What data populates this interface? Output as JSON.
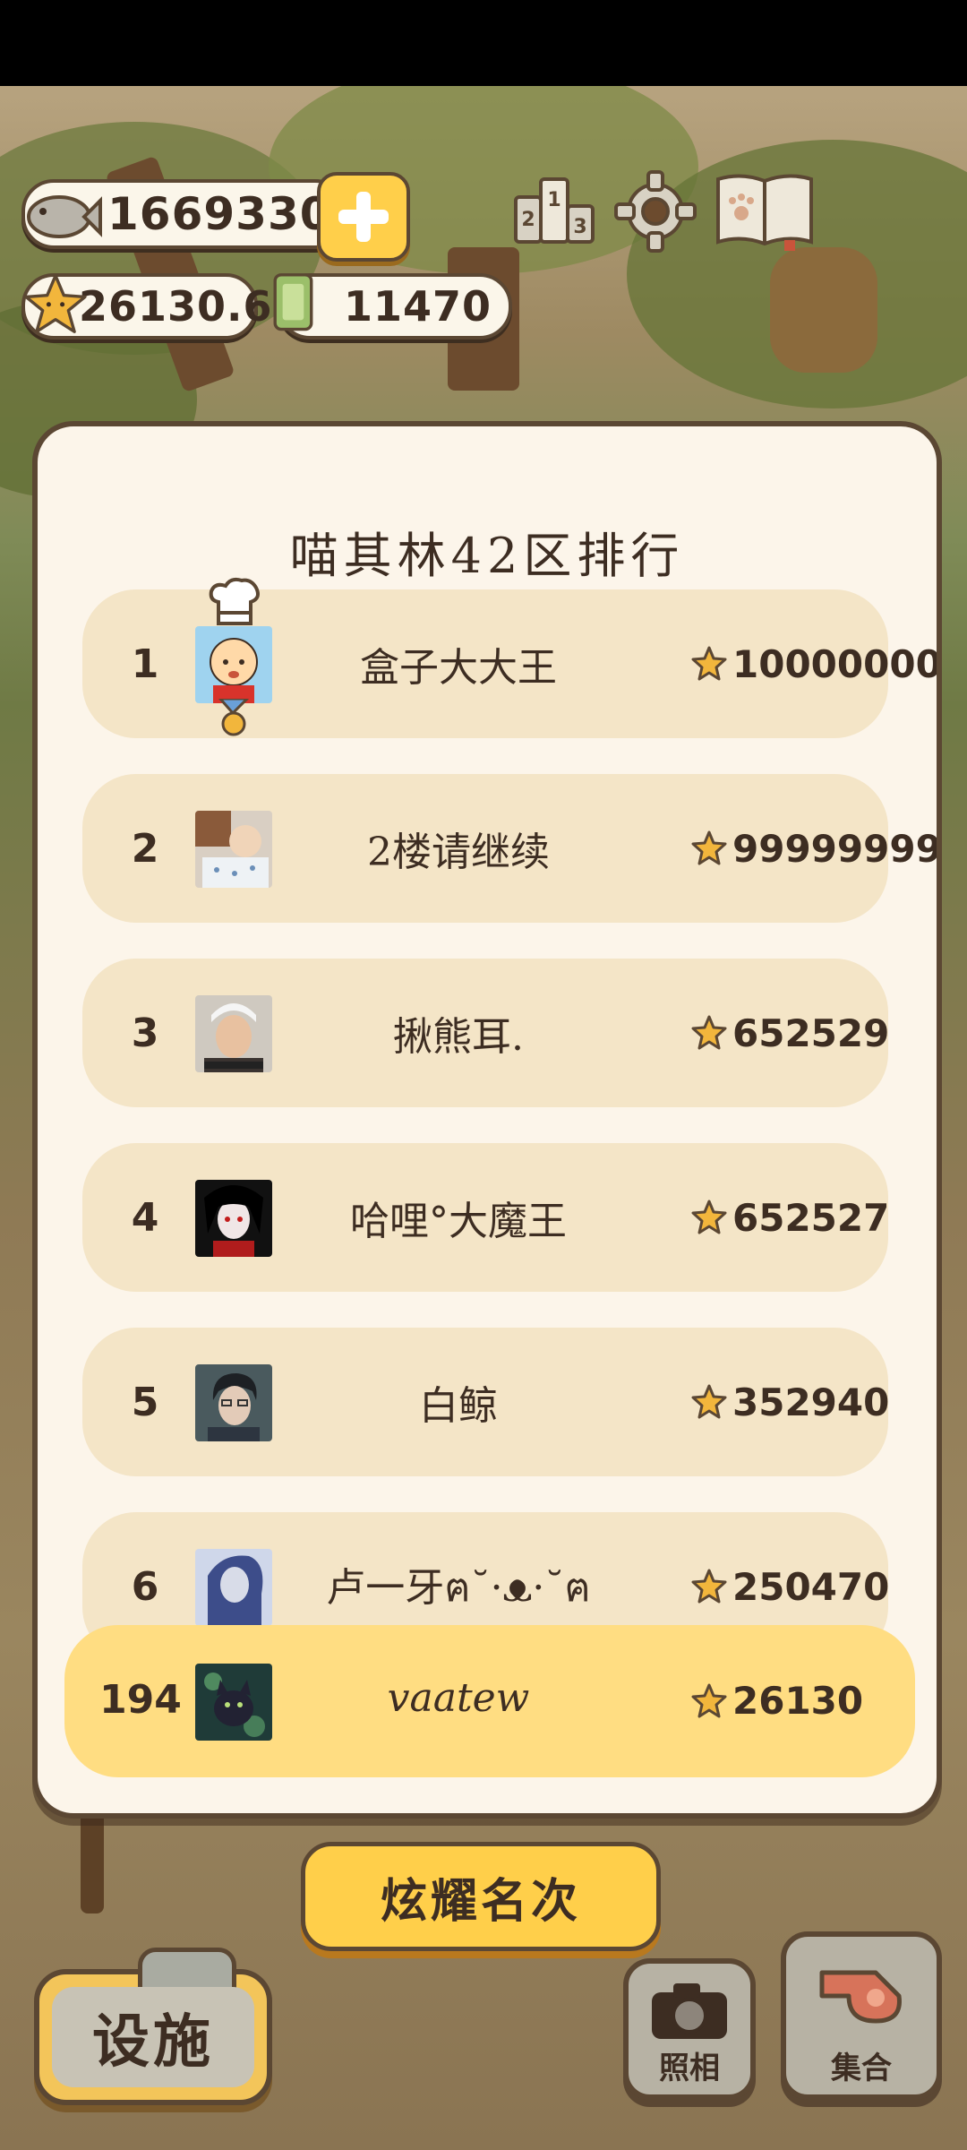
{
  "hud": {
    "fish": "1669330",
    "stars": "26130.6",
    "cash": "11470"
  },
  "leaderboard": {
    "title": "喵其林42区排行",
    "entries": [
      {
        "rank": "1",
        "name": "盒子大大王",
        "score": "10000000"
      },
      {
        "rank": "2",
        "name": "2楼请继续",
        "score": "99999999"
      },
      {
        "rank": "3",
        "name": "揪熊耳.",
        "score": "652529"
      },
      {
        "rank": "4",
        "name": "哈哩°大魔王",
        "score": "652527"
      },
      {
        "rank": "5",
        "name": "白鲸",
        "score": "352940"
      },
      {
        "rank": "6",
        "name": "卢一牙ฅ˘·ᴥ·˘ฅ",
        "score": "250470"
      }
    ],
    "me": {
      "rank": "194",
      "name": "vaatew",
      "score": "26130"
    }
  },
  "buttons": {
    "show_rank": "炫耀名次",
    "facility": "设施",
    "photo": "照相",
    "gather": "集合"
  },
  "colors": {
    "accent": "#ffcf4a",
    "row": "#f4e5c7",
    "my_row": "#ffdd82",
    "panel": "#fcf5ea",
    "outline": "#5b4733"
  }
}
